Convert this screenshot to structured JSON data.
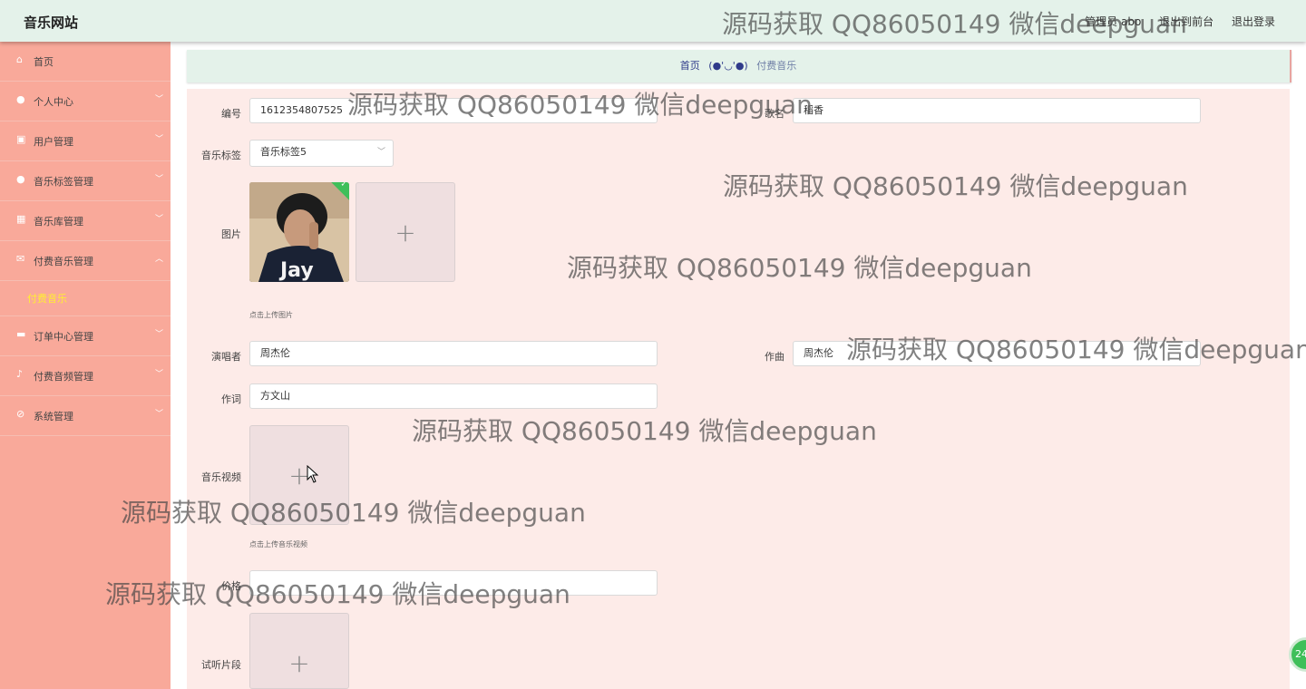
{
  "header": {
    "app_title": "音乐网站",
    "links": [
      "管理员 abo",
      "退出到前台",
      "退出登录"
    ]
  },
  "sidebar": {
    "items": [
      {
        "label": "首页",
        "icon": "home-icon",
        "expanded": false
      },
      {
        "label": "个人中心",
        "icon": "person-icon",
        "expanded": false
      },
      {
        "label": "用户管理",
        "icon": "users-icon",
        "expanded": false
      },
      {
        "label": "音乐标签管理",
        "icon": "tag-icon",
        "expanded": false
      },
      {
        "label": "音乐库管理",
        "icon": "grid-icon",
        "expanded": false
      },
      {
        "label": "付费音乐管理",
        "icon": "envelope-icon",
        "expanded": true
      },
      {
        "label": "订单中心管理",
        "icon": "chat-icon",
        "expanded": false
      },
      {
        "label": "付费音频管理",
        "icon": "microphone-icon",
        "expanded": false
      },
      {
        "label": "系统管理",
        "icon": "settings-icon",
        "expanded": false
      }
    ],
    "active_sub": "付费音乐"
  },
  "breadcrumb": {
    "home": "首页",
    "separator": "(●'◡'●)",
    "current": "付费音乐"
  },
  "form": {
    "id_label": "编号",
    "id_value": "1612354807525",
    "song_label": "歌名",
    "song_value": "稻香",
    "tag_label": "音乐标签",
    "tag_value": "音乐标签5",
    "image_label": "图片",
    "image_hint": "点击上传图片",
    "singer_label": "演唱者",
    "singer_value": "周杰伦",
    "composer_label": "作曲",
    "composer_value": "周杰伦",
    "lyricist_label": "作词",
    "lyricist_value": "方文山",
    "video_label": "音乐视频",
    "video_hint": "点击上传音乐视频",
    "price_label": "价格",
    "price_value": "",
    "preview_label": "试听片段",
    "album_text": "Jay"
  },
  "watermark_text": "源码获取 QQ86050149 微信deepguan",
  "help_badge": "24",
  "colors": {
    "sidebar_bg": "#f9a99a",
    "topbar_bg": "#e4f2ea",
    "form_bg": "#fdebe8",
    "active_sub": "#ffee33",
    "badge_green": "#3fbf5a"
  }
}
